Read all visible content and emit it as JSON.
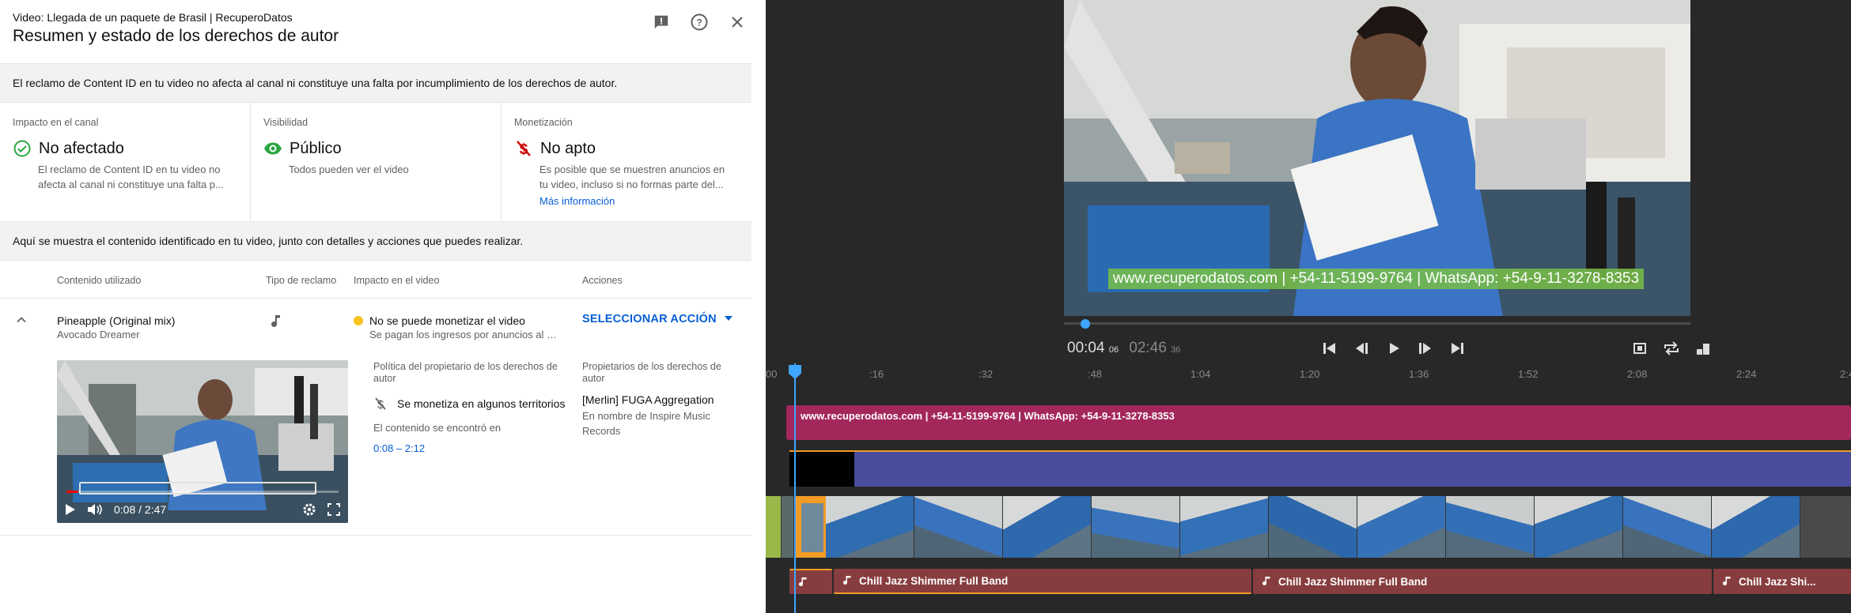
{
  "dialog": {
    "subtitle": "Video: Llegada de un paquete de Brasil | RecuperoDatos",
    "title": "Resumen y estado de los derechos de autor",
    "notice": "El reclamo de Content ID en tu video no afecta al canal ni constituye una falta por incumplimiento de los derechos de autor.",
    "cards": [
      {
        "label": "Impacto en el canal",
        "value": "No afectado",
        "desc1": "El reclamo de Content ID en tu video no",
        "desc2": "afecta al canal ni constituye una falta p...",
        "icon": "check-circle-icon"
      },
      {
        "label": "Visibilidad",
        "value": "Público",
        "desc1": "Todos pueden ver el video",
        "icon": "eye-icon"
      },
      {
        "label": "Monetización",
        "value": "No apto",
        "desc1": "Es posible que se muestren anuncios en",
        "desc2": "tu video, incluso si no formas parte del...",
        "link": "Más información",
        "icon": "demonetized-icon"
      }
    ],
    "notice2": "Aquí se muestra el contenido identificado en tu video, junto con detalles y acciones que puedes realizar.",
    "table": {
      "headers": [
        "Contenido utilizado",
        "Tipo de reclamo",
        "Impacto en el video",
        "Acciones"
      ],
      "row": {
        "song": "Pineapple (Original mix)",
        "artist": "Avocado Dreamer",
        "impact": "No se puede monetizar el video",
        "impact_sub": "Se pagan los ingresos por anuncios al pro...",
        "action": "SELECCIONAR ACCIÓN",
        "player_time": "0:08 / 2:47",
        "policy_label": "Política del propietario de los derechos de autor",
        "policy": "Se monetiza en algunos territorios",
        "found_label": "El contenido se encontró en",
        "found_range": "0:08 – 2:12",
        "owners_label": "Propietarios de los derechos de autor",
        "owner": "[Merlin] FUGA Aggregation",
        "owner_sub": "En nombre de Inspire Music Records"
      }
    }
  },
  "editor": {
    "overlay_text": "www.recuperodatos.com | +54-11-5199-9764 | WhatsApp: +54-9-11-3278-8353",
    "current_time": "00:04",
    "current_frames": "06",
    "total_time": "02:46",
    "total_frames": "36",
    "ruler": [
      "00",
      ":16",
      ":32",
      ":48",
      "1:04",
      "1:20",
      "1:36",
      "1:52",
      "2:08",
      "2:24",
      "2:4"
    ],
    "text_track": "www.recuperodatos.com | +54-11-5199-9764 | WhatsApp: +54-9-11-3278-8353",
    "audio": [
      "Chill Jazz Shimmer Full Band",
      "Chill Jazz Shimmer Full Band",
      "Chill Jazz Shi..."
    ],
    "accent": "#3ea6ff"
  }
}
